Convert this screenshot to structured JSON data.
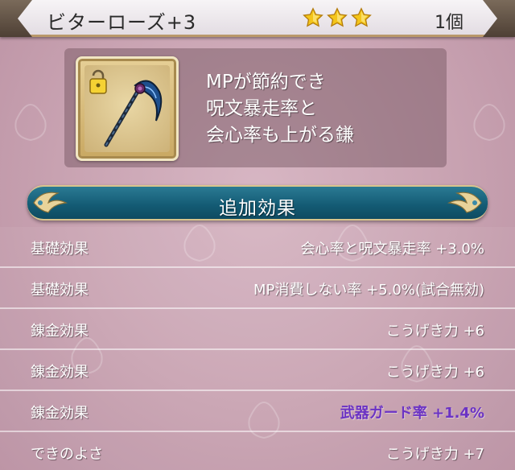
{
  "header": {
    "item_name": "ビターローズ+3",
    "stars": 3,
    "count": "1個"
  },
  "item": {
    "icon": "scythe-icon",
    "lock_icon": "lock-icon",
    "description_lines": [
      "MPが節約でき",
      "呪文暴走率と",
      "会心率も上がる鎌"
    ]
  },
  "section": {
    "title": "追加効果"
  },
  "effects": [
    {
      "label": "基礎効果",
      "value": "会心率と呪文暴走率 +3.0%",
      "highlight": false
    },
    {
      "label": "基礎効果",
      "value": "MP消費しない率 +5.0%(試合無効)",
      "highlight": false
    },
    {
      "label": "錬金効果",
      "value": "こうげき力 +6",
      "highlight": false
    },
    {
      "label": "錬金効果",
      "value": "こうげき力 +6",
      "highlight": false
    },
    {
      "label": "錬金効果",
      "value": "武器ガード率 +1.4%",
      "highlight": true
    },
    {
      "label": "できのよさ",
      "value": "こうげき力 +7",
      "highlight": false
    }
  ],
  "colors": {
    "highlight_value": "#6b33c4",
    "banner": "#135a73",
    "star": "#f4c51a"
  }
}
